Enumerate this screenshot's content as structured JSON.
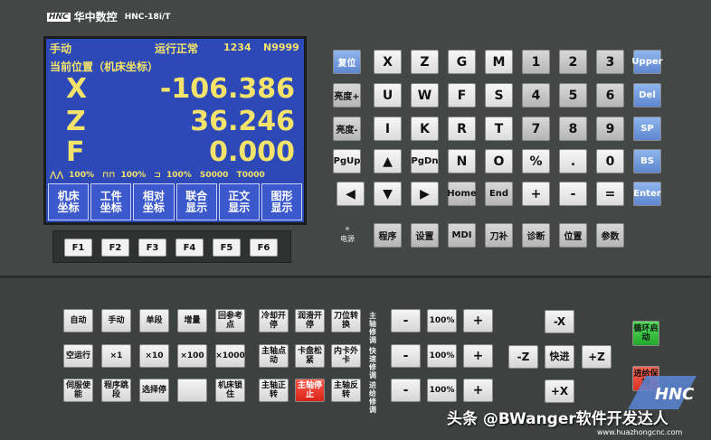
{
  "brand": {
    "logo_mark": "HNC",
    "name": "华中数控",
    "model": "HNC-18i/T"
  },
  "screen": {
    "mode": "手动",
    "status": "运行正常",
    "program_no": "1234",
    "block_no": "N9999",
    "position_title": "当前位置（机床坐标）",
    "axes": [
      {
        "name": "X",
        "value": "-106.386"
      },
      {
        "name": "Z",
        "value": "36.246"
      },
      {
        "name": "F",
        "value": "0.000"
      }
    ],
    "status_row": [
      "100%",
      "100%",
      "100%",
      "S0000",
      "T0000"
    ],
    "softkeys": [
      {
        "l1": "机床",
        "l2": "坐标"
      },
      {
        "l1": "工件",
        "l2": "坐标"
      },
      {
        "l1": "相对",
        "l2": "坐标"
      },
      {
        "l1": "联合",
        "l2": "显示"
      },
      {
        "l1": "正文",
        "l2": "显示"
      },
      {
        "l1": "图形",
        "l2": "显示"
      }
    ]
  },
  "fkeys": [
    "F1",
    "F2",
    "F3",
    "F4",
    "F5",
    "F6"
  ],
  "keypad": {
    "reset": "复位",
    "row1": [
      "X",
      "Z",
      "G",
      "M",
      "1",
      "2",
      "3"
    ],
    "upper": "Upper",
    "row2": [
      "U",
      "W",
      "F",
      "S",
      "4",
      "5",
      "6"
    ],
    "del": "Del",
    "row3": [
      "I",
      "K",
      "R",
      "T",
      "7",
      "8",
      "9"
    ],
    "sp": "SP",
    "pgup": "PgUp",
    "pgdn": "PgDn",
    "row4": [
      "N",
      "O",
      "%",
      ".",
      "0"
    ],
    "bs": "BS",
    "home": "Home",
    "end": "End",
    "row5_ops": [
      "+",
      "-",
      "="
    ],
    "enter": "Enter",
    "bright_plus": "亮度+",
    "bright_minus": "亮度-",
    "arrows": {
      "up": "▲",
      "down": "▼",
      "left": "◀",
      "right": "▶"
    },
    "power_label": "电源",
    "func": [
      "程序",
      "设置",
      "MDI",
      "刀补",
      "诊断",
      "位置",
      "参数"
    ]
  },
  "machine": {
    "row1": [
      "自动",
      "手动",
      "单段",
      "增量",
      "回参考点"
    ],
    "row2": [
      "空运行",
      "×1",
      "×10",
      "×100",
      "×1000"
    ],
    "row3": [
      "伺服使能",
      "程序跳段",
      "选择停",
      "",
      "机床锁住"
    ],
    "col_a": [
      "冷却开停",
      "主轴点动",
      "主轴正转"
    ],
    "col_b": [
      "润滑开停",
      "卡盘松紧",
      "主轴停止"
    ],
    "col_c": [
      "刀位转换",
      "内卡外卡",
      "主轴反转"
    ],
    "labels": [
      "主轴修调",
      "快速修调",
      "进给修调"
    ],
    "override": [
      "-",
      "100%",
      "+"
    ],
    "jog": {
      "mx": "-X",
      "mz": "-Z",
      "rapid": "快进",
      "pz": "+Z",
      "px": "+X"
    },
    "cycle_start": "循环启动",
    "feed_hold": "进给保持"
  },
  "watermark": "头条 @BWanger软件开发达人",
  "url": "www.huazhongcnc.com",
  "colors": {
    "screen": "#2d49b8",
    "text": "#f3e36a",
    "blue_key": "#6f96dd",
    "red_key": "#d8231a",
    "green_key": "#22a62a"
  }
}
